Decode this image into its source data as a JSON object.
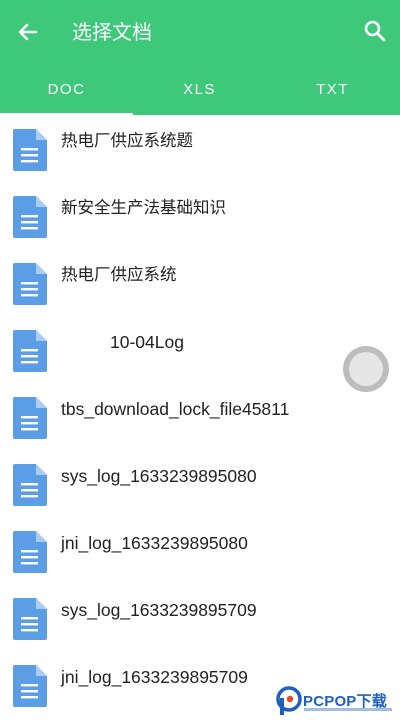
{
  "header": {
    "title": "选择文档",
    "back_icon": "arrow-left-icon",
    "search_icon": "search-icon",
    "color": "#3dc87a"
  },
  "tabs": [
    {
      "label": "DOC",
      "active": true
    },
    {
      "label": "XLS",
      "active": false
    },
    {
      "label": "TXT",
      "active": false
    }
  ],
  "files": [
    {
      "name": "热电厂供应系统题",
      "icon": "document-icon"
    },
    {
      "name": "新安全生产法基础知识",
      "icon": "document-icon"
    },
    {
      "name": "热电厂供应系统",
      "icon": "document-icon"
    },
    {
      "name": "10-04Log",
      "icon": "document-icon"
    },
    {
      "name": "tbs_download_lock_file45811",
      "icon": "document-icon"
    },
    {
      "name": "sys_log_1633239895080",
      "icon": "document-icon"
    },
    {
      "name": "jni_log_1633239895080",
      "icon": "document-icon"
    },
    {
      "name": "sys_log_1633239895709",
      "icon": "document-icon"
    },
    {
      "name": "jni_log_1633239895709",
      "icon": "document-icon"
    }
  ],
  "watermark": {
    "text": "PCPOP下载",
    "color": "#1e5fc0"
  },
  "colors": {
    "doc_icon": "#5b9ee6",
    "doc_icon_fold": "#a9cdf5"
  }
}
